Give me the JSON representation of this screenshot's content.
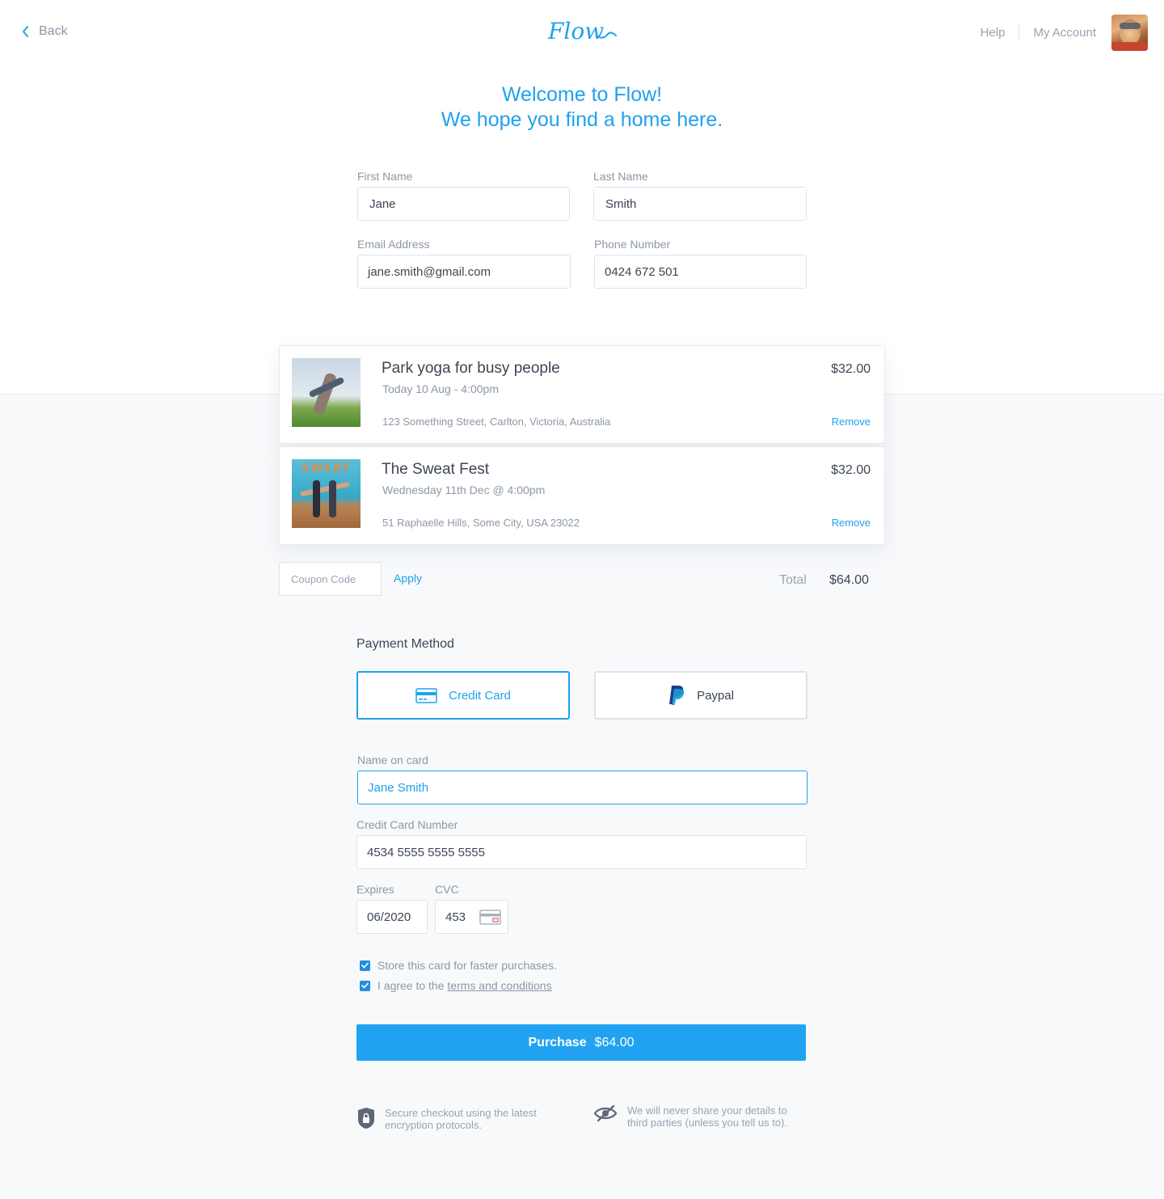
{
  "header": {
    "back_label": "Back",
    "logo_text": "Flow",
    "help_label": "Help",
    "account_label": "My Account"
  },
  "welcome": {
    "line1": "Welcome to Flow!",
    "line2": "We hope you find a home here."
  },
  "form": {
    "first_name": {
      "label": "First Name",
      "value": "Jane"
    },
    "last_name": {
      "label": "Last Name",
      "value": "Smith"
    },
    "email": {
      "label": "Email Address",
      "value": "jane.smith@gmail.com"
    },
    "phone": {
      "label": "Phone Number",
      "value": "0424 672 501"
    }
  },
  "cart": {
    "items": [
      {
        "title": "Park yoga for busy people",
        "date": "Today 10 Aug - 4:00pm",
        "address": "123 Something Street, Carlton, Victoria, Australia",
        "price": "$32.00",
        "remove_label": "Remove"
      },
      {
        "title": "The Sweat Fest",
        "date": "Wednesday 11th Dec @ 4:00pm",
        "address": "51 Raphaelle Hills, Some City, USA 23022",
        "price": "$32.00",
        "remove_label": "Remove",
        "thumb_text": "SWEAT"
      }
    ],
    "coupon_placeholder": "Coupon Code",
    "apply_label": "Apply",
    "total_label": "Total",
    "total_value": "$64.00"
  },
  "payment": {
    "title": "Payment Method",
    "credit_card_label": "Credit Card",
    "paypal_label": "Paypal",
    "name_on_card": {
      "label": "Name on card",
      "value": "Jane Smith"
    },
    "card_number": {
      "label": "Credit Card Number",
      "value": "4534 5555 5555 5555"
    },
    "expires": {
      "label": "Expires",
      "value": "06/2020"
    },
    "cvc": {
      "label": "CVC",
      "value": "453"
    },
    "store_card_label": "Store this card for faster purchases.",
    "agree_label": "I agree to the",
    "terms_label": "terms and conditions",
    "purchase_label": "Purchase",
    "purchase_amount": "$64.00"
  },
  "footer": {
    "secure_line1": "Secure checkout using the latest",
    "secure_line2": "encryption protocols.",
    "privacy_line1": "We will never share your details to",
    "privacy_line2": "third parties (unless you tell us to)."
  },
  "colors": {
    "accent": "#1fa2ee",
    "purchase_button": "#21a3f1",
    "text_dark": "#3c4654",
    "text_muted": "#8c98a6"
  }
}
